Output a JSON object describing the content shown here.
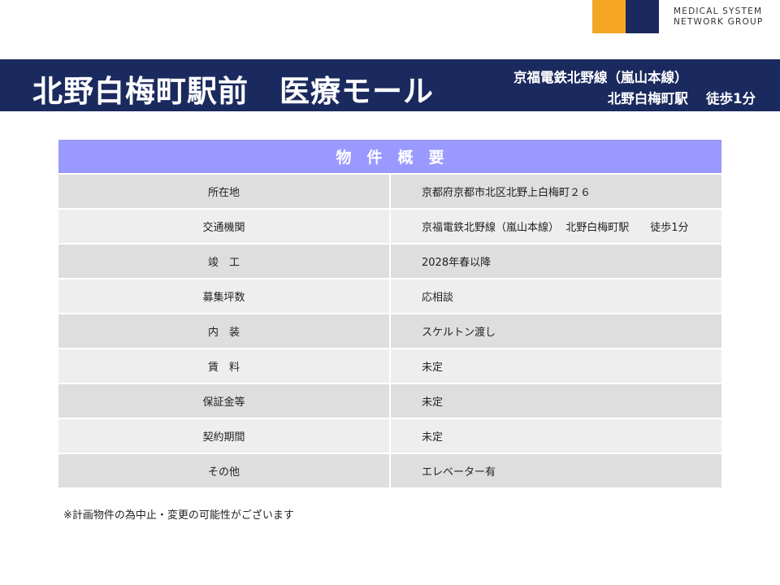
{
  "logo": {
    "line1": "MEDICAL SYSTEM",
    "line2": "NETWORK GROUP",
    "colors": {
      "orange": "#f5a623",
      "navy": "#1b2a5e"
    }
  },
  "banner": {
    "title": "北野白梅町駅前　医療モール",
    "line_name": "京福電鉄北野線（嵐山本線）",
    "station": "北野白梅町駅　 徒歩1分"
  },
  "table": {
    "heading": "物　件　概　要",
    "rows": [
      {
        "label": "所在地",
        "value": "京都府京都市北区北野上白梅町２６"
      },
      {
        "label": "交通機関",
        "value": "京福電鉄北野線（嵐山本線）  北野白梅町駅　　徒歩1分"
      },
      {
        "label": "竣　工",
        "value": "2028年春以降"
      },
      {
        "label": "募集坪数",
        "value": "応相談"
      },
      {
        "label": "内　装",
        "value": "スケルトン渡し"
      },
      {
        "label": "賃　料",
        "value": "未定"
      },
      {
        "label": "保証金等",
        "value": "未定"
      },
      {
        "label": "契約期間",
        "value": "未定"
      },
      {
        "label": "その他",
        "value": "エレベーター有"
      }
    ]
  },
  "note": "※計画物件の為中止・変更の可能性がございます"
}
